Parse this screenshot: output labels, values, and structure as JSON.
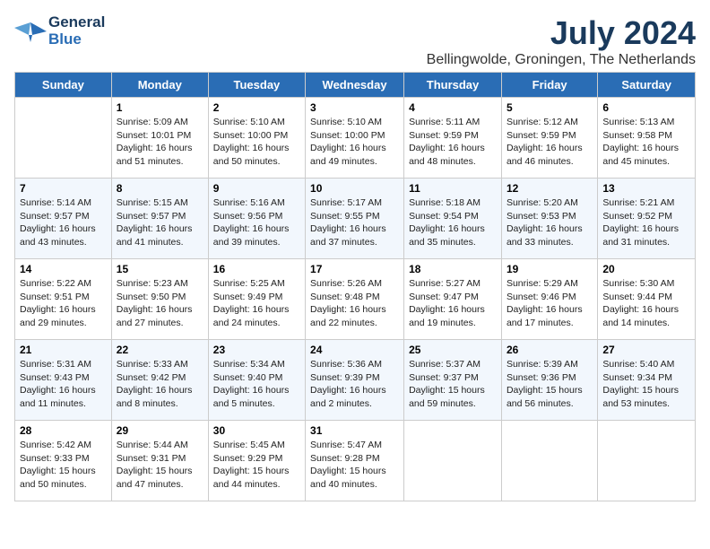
{
  "header": {
    "logo_line1": "General",
    "logo_line2": "Blue",
    "month_year": "July 2024",
    "location": "Bellingwolde, Groningen, The Netherlands"
  },
  "days_of_week": [
    "Sunday",
    "Monday",
    "Tuesday",
    "Wednesday",
    "Thursday",
    "Friday",
    "Saturday"
  ],
  "weeks": [
    [
      {
        "day": "",
        "info": ""
      },
      {
        "day": "1",
        "info": "Sunrise: 5:09 AM\nSunset: 10:01 PM\nDaylight: 16 hours\nand 51 minutes."
      },
      {
        "day": "2",
        "info": "Sunrise: 5:10 AM\nSunset: 10:00 PM\nDaylight: 16 hours\nand 50 minutes."
      },
      {
        "day": "3",
        "info": "Sunrise: 5:10 AM\nSunset: 10:00 PM\nDaylight: 16 hours\nand 49 minutes."
      },
      {
        "day": "4",
        "info": "Sunrise: 5:11 AM\nSunset: 9:59 PM\nDaylight: 16 hours\nand 48 minutes."
      },
      {
        "day": "5",
        "info": "Sunrise: 5:12 AM\nSunset: 9:59 PM\nDaylight: 16 hours\nand 46 minutes."
      },
      {
        "day": "6",
        "info": "Sunrise: 5:13 AM\nSunset: 9:58 PM\nDaylight: 16 hours\nand 45 minutes."
      }
    ],
    [
      {
        "day": "7",
        "info": "Sunrise: 5:14 AM\nSunset: 9:57 PM\nDaylight: 16 hours\nand 43 minutes."
      },
      {
        "day": "8",
        "info": "Sunrise: 5:15 AM\nSunset: 9:57 PM\nDaylight: 16 hours\nand 41 minutes."
      },
      {
        "day": "9",
        "info": "Sunrise: 5:16 AM\nSunset: 9:56 PM\nDaylight: 16 hours\nand 39 minutes."
      },
      {
        "day": "10",
        "info": "Sunrise: 5:17 AM\nSunset: 9:55 PM\nDaylight: 16 hours\nand 37 minutes."
      },
      {
        "day": "11",
        "info": "Sunrise: 5:18 AM\nSunset: 9:54 PM\nDaylight: 16 hours\nand 35 minutes."
      },
      {
        "day": "12",
        "info": "Sunrise: 5:20 AM\nSunset: 9:53 PM\nDaylight: 16 hours\nand 33 minutes."
      },
      {
        "day": "13",
        "info": "Sunrise: 5:21 AM\nSunset: 9:52 PM\nDaylight: 16 hours\nand 31 minutes."
      }
    ],
    [
      {
        "day": "14",
        "info": "Sunrise: 5:22 AM\nSunset: 9:51 PM\nDaylight: 16 hours\nand 29 minutes."
      },
      {
        "day": "15",
        "info": "Sunrise: 5:23 AM\nSunset: 9:50 PM\nDaylight: 16 hours\nand 27 minutes."
      },
      {
        "day": "16",
        "info": "Sunrise: 5:25 AM\nSunset: 9:49 PM\nDaylight: 16 hours\nand 24 minutes."
      },
      {
        "day": "17",
        "info": "Sunrise: 5:26 AM\nSunset: 9:48 PM\nDaylight: 16 hours\nand 22 minutes."
      },
      {
        "day": "18",
        "info": "Sunrise: 5:27 AM\nSunset: 9:47 PM\nDaylight: 16 hours\nand 19 minutes."
      },
      {
        "day": "19",
        "info": "Sunrise: 5:29 AM\nSunset: 9:46 PM\nDaylight: 16 hours\nand 17 minutes."
      },
      {
        "day": "20",
        "info": "Sunrise: 5:30 AM\nSunset: 9:44 PM\nDaylight: 16 hours\nand 14 minutes."
      }
    ],
    [
      {
        "day": "21",
        "info": "Sunrise: 5:31 AM\nSunset: 9:43 PM\nDaylight: 16 hours\nand 11 minutes."
      },
      {
        "day": "22",
        "info": "Sunrise: 5:33 AM\nSunset: 9:42 PM\nDaylight: 16 hours\nand 8 minutes."
      },
      {
        "day": "23",
        "info": "Sunrise: 5:34 AM\nSunset: 9:40 PM\nDaylight: 16 hours\nand 5 minutes."
      },
      {
        "day": "24",
        "info": "Sunrise: 5:36 AM\nSunset: 9:39 PM\nDaylight: 16 hours\nand 2 minutes."
      },
      {
        "day": "25",
        "info": "Sunrise: 5:37 AM\nSunset: 9:37 PM\nDaylight: 15 hours\nand 59 minutes."
      },
      {
        "day": "26",
        "info": "Sunrise: 5:39 AM\nSunset: 9:36 PM\nDaylight: 15 hours\nand 56 minutes."
      },
      {
        "day": "27",
        "info": "Sunrise: 5:40 AM\nSunset: 9:34 PM\nDaylight: 15 hours\nand 53 minutes."
      }
    ],
    [
      {
        "day": "28",
        "info": "Sunrise: 5:42 AM\nSunset: 9:33 PM\nDaylight: 15 hours\nand 50 minutes."
      },
      {
        "day": "29",
        "info": "Sunrise: 5:44 AM\nSunset: 9:31 PM\nDaylight: 15 hours\nand 47 minutes."
      },
      {
        "day": "30",
        "info": "Sunrise: 5:45 AM\nSunset: 9:29 PM\nDaylight: 15 hours\nand 44 minutes."
      },
      {
        "day": "31",
        "info": "Sunrise: 5:47 AM\nSunset: 9:28 PM\nDaylight: 15 hours\nand 40 minutes."
      },
      {
        "day": "",
        "info": ""
      },
      {
        "day": "",
        "info": ""
      },
      {
        "day": "",
        "info": ""
      }
    ]
  ]
}
